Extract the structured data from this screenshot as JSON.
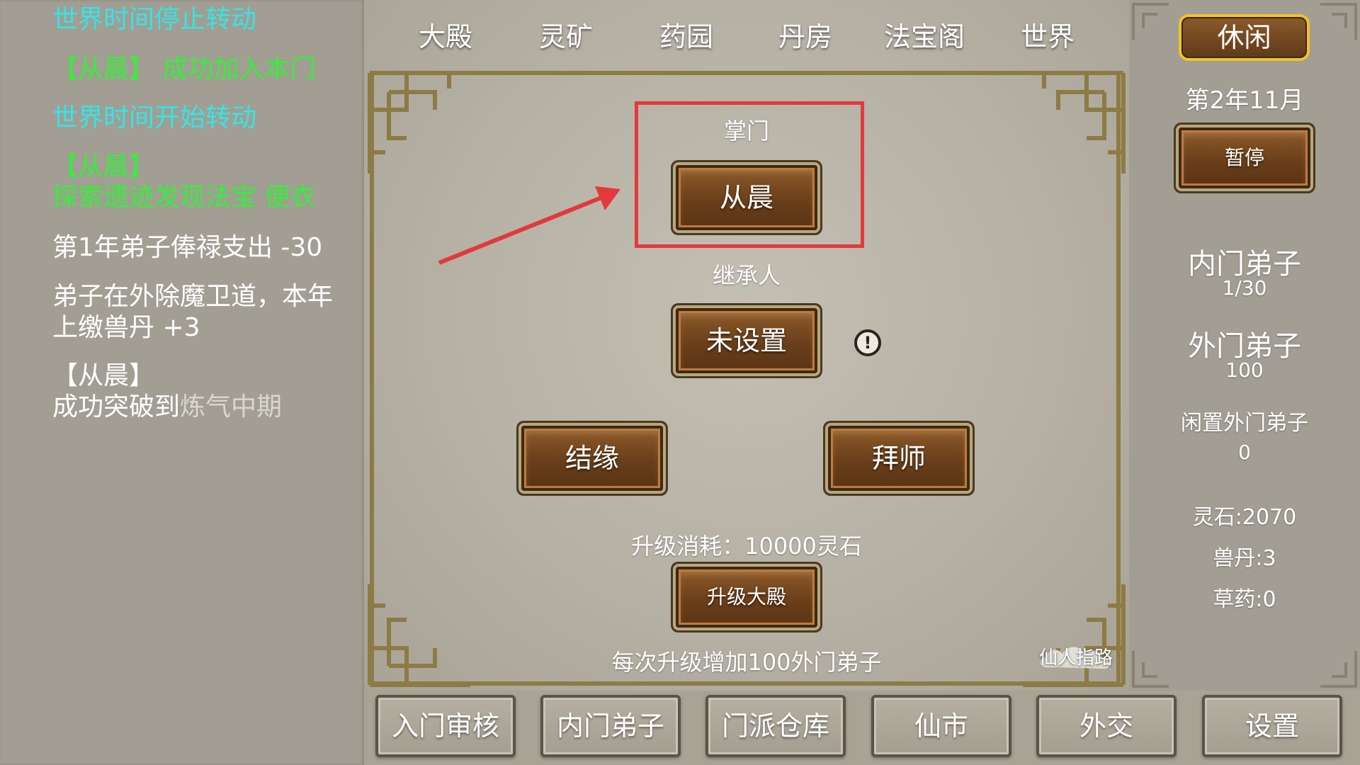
{
  "log": {
    "lines": [
      {
        "text": "世界时间停止转动"
      },
      {
        "text": "【从晨】 成功加入本门"
      },
      {
        "text": "世界时间开始转动"
      },
      {
        "text": "【从晨】"
      },
      {
        "text": "探索遗迹发现法宝 便衣"
      },
      {
        "text": "第1年弟子俸禄支出 -30"
      },
      {
        "text": "弟子在外除魔卫道，本年"
      },
      {
        "text": "上缴兽丹 +3"
      },
      {
        "text": "【从晨】"
      },
      {
        "text": "成功突破到"
      },
      {
        "text": "炼气中期"
      }
    ]
  },
  "tabs": [
    "大殿",
    "灵矿",
    "药园",
    "丹房",
    "法宝阁",
    "世界"
  ],
  "hall": {
    "leader_label": "掌门",
    "leader_name": "从晨",
    "heir_label": "继承人",
    "heir_value": "未设置",
    "alert_icon": "!",
    "marry_button": "结缘",
    "apprentice_button": "拜师",
    "upgrade_cost": "升级消耗：10000灵石",
    "upgrade_button": "升级大殿",
    "upgrade_note": "每次升级增加100外门弟子",
    "guide_text": "仙人指路"
  },
  "status": {
    "mode": "休闲",
    "date": "第2年11月",
    "pause_button": "暂停",
    "inner_label": "内门弟子",
    "inner_value": "1/30",
    "outer_label": "外门弟子",
    "outer_value": "100",
    "idle_outer_label": "闲置外门弟子",
    "idle_outer_value": "0",
    "spirit_stone": "灵石:2070",
    "beast_pill": "兽丹:3",
    "herbs": "草药:0"
  },
  "bottom_nav": [
    "入门审核",
    "内门弟子",
    "门派仓库",
    "仙市",
    "外交",
    "设置"
  ],
  "colors": {
    "cyan": "#33e5e8",
    "green": "#34f03a",
    "highlight": "#e3393c",
    "frame": "#8d7b45",
    "badge_border": "#f2c227"
  }
}
